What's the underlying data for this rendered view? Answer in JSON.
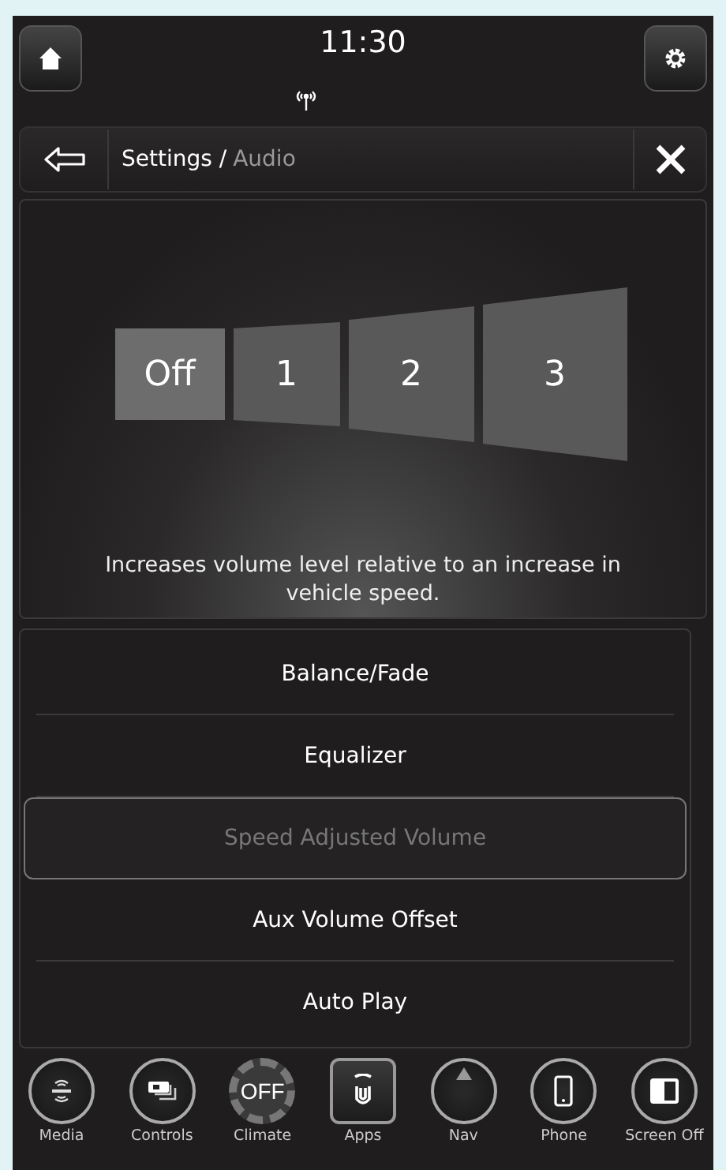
{
  "status_bar": {
    "time": "11:30"
  },
  "breadcrumb": {
    "path": "Settings /",
    "current": "Audio"
  },
  "speed_volume": {
    "options": [
      {
        "label": "Off",
        "selected": true
      },
      {
        "label": "1",
        "selected": false
      },
      {
        "label": "2",
        "selected": false
      },
      {
        "label": "3",
        "selected": false
      }
    ],
    "description": "Increases volume level relative to an increase in vehicle speed."
  },
  "menu": [
    {
      "label": "Balance/Fade",
      "selected": false
    },
    {
      "label": "Equalizer",
      "selected": false
    },
    {
      "label": "Speed Adjusted Volume",
      "selected": true
    },
    {
      "label": "Aux Volume Offset",
      "selected": false
    },
    {
      "label": "Auto Play",
      "selected": false
    }
  ],
  "nav": [
    {
      "kind": "media",
      "label": "Media",
      "selected": false
    },
    {
      "kind": "controls",
      "label": "Controls",
      "selected": false
    },
    {
      "kind": "climate",
      "label": "Climate",
      "icon_text": "OFF",
      "selected": false
    },
    {
      "kind": "apps",
      "label": "Apps",
      "selected": true
    },
    {
      "kind": "nav",
      "label": "Nav",
      "selected": false
    },
    {
      "kind": "phone",
      "label": "Phone",
      "selected": false
    },
    {
      "kind": "screen",
      "label": "Screen Off",
      "selected": false
    }
  ]
}
